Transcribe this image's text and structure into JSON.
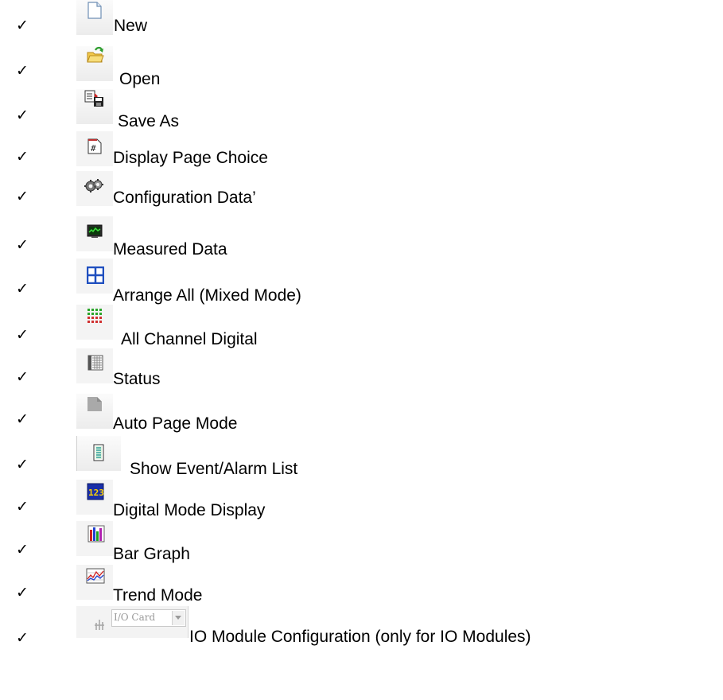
{
  "items": [
    {
      "check": "✓",
      "label": "New",
      "icon": "new-document-icon"
    },
    {
      "check": "✓",
      "label": "Open",
      "icon": "open-folder-icon"
    },
    {
      "check": "✓",
      "label": "Save As",
      "icon": "save-as-icon"
    },
    {
      "check": "✓",
      "label": "Display Page Choice",
      "icon": "display-page-choice-icon"
    },
    {
      "check": "✓",
      "label": "Configuration Data’",
      "icon": "gear-icon"
    },
    {
      "check": "✓",
      "label": "Measured Data",
      "icon": "measured-data-icon"
    },
    {
      "check": "✓",
      "label": "Arrange All (Mixed Mode)",
      "icon": "arrange-all-icon"
    },
    {
      "check": "✓",
      "label": "All Channel Digital",
      "icon": "all-channel-digital-icon"
    },
    {
      "check": "✓",
      "label": "Status",
      "icon": "status-icon"
    },
    {
      "check": "✓",
      "label": "Auto Page Mode",
      "icon": "auto-page-mode-icon"
    },
    {
      "check": "✓",
      "label": "Show Event/Alarm List",
      "icon": "event-alarm-list-icon"
    },
    {
      "check": "✓",
      "label": "Digital Mode Display",
      "icon": "digital-mode-display-icon"
    },
    {
      "check": "✓",
      "label": "Bar Graph",
      "icon": "bar-graph-icon"
    },
    {
      "check": "✓",
      "label": "Trend Mode",
      "icon": "trend-mode-icon"
    },
    {
      "check": "✓",
      "label": "IO Module Configuration (only for IO Modules)",
      "icon": "io-card-combo"
    }
  ],
  "io_combo": {
    "value": "I/O Card"
  },
  "colors": {
    "text": "#000000",
    "toolbar_bg": "#f0f0f0",
    "accent_blue": "#1f4fbf",
    "accent_green": "#1f9a2a"
  }
}
